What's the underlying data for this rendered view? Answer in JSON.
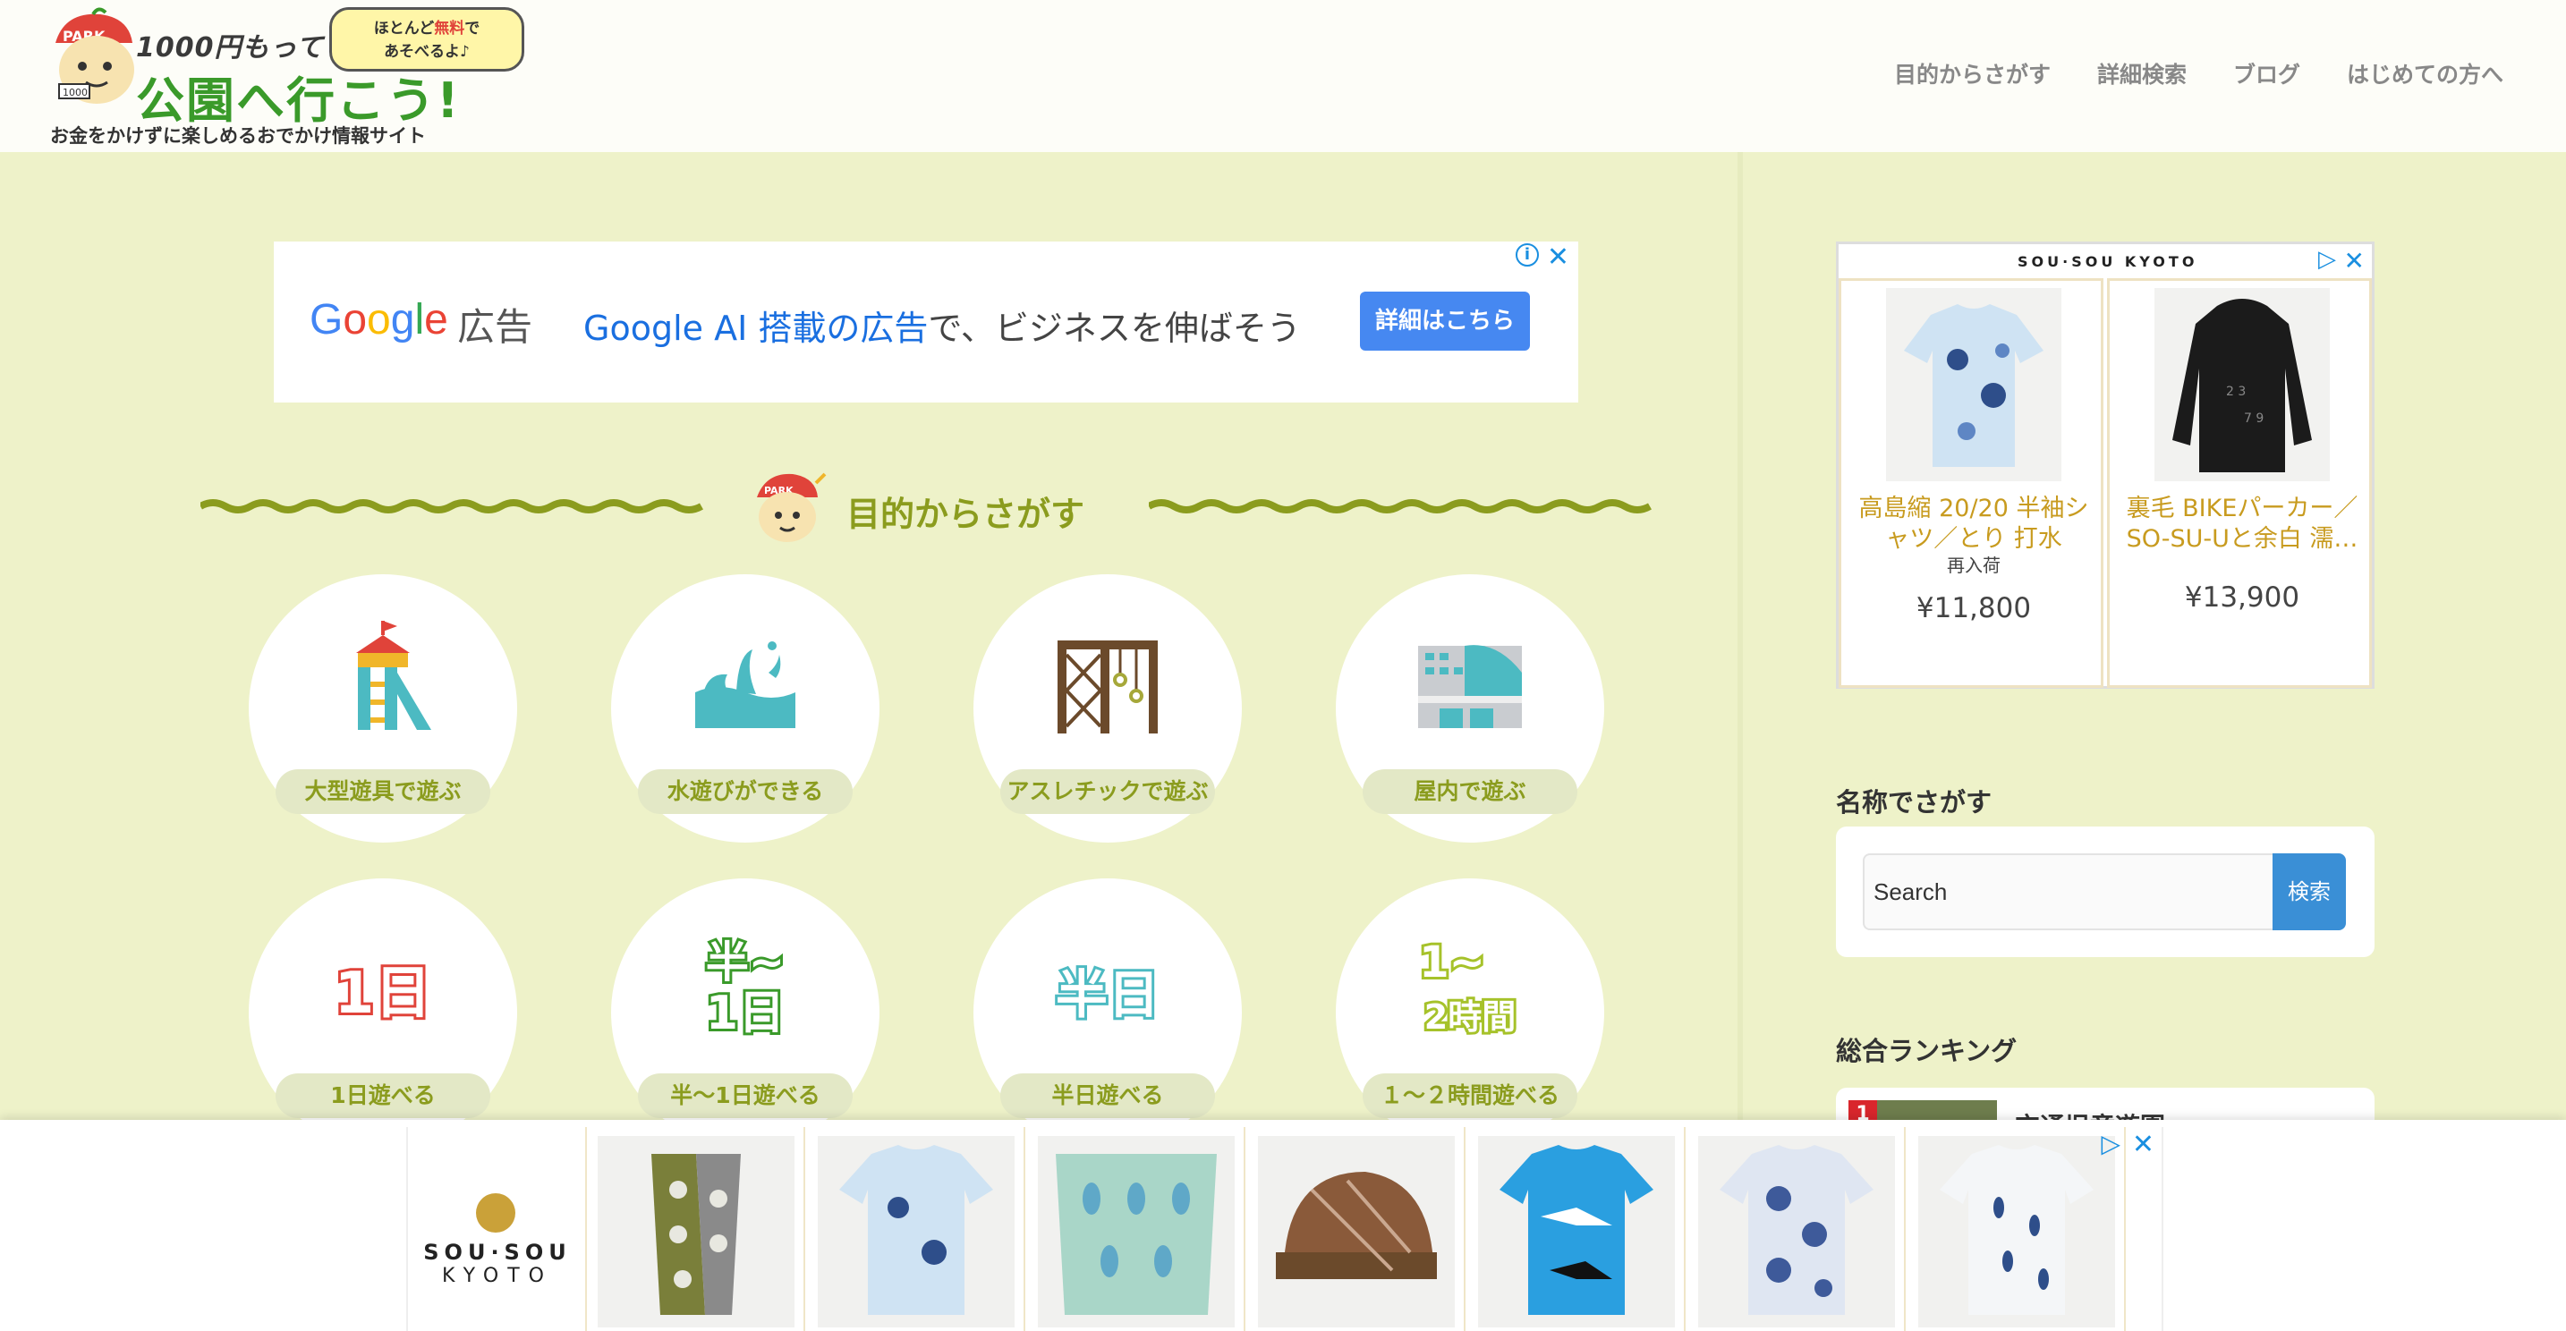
{
  "header": {
    "logo_title": "1000円もって",
    "logo_title2": "公園へ行こう!",
    "logo_bubble_line1": "ほとんど",
    "logo_bubble_red": "無料",
    "logo_bubble_line1b": "で",
    "logo_bubble_line2": "あそべるよ♪",
    "tagline": "お金をかけずに楽しめるおでかけ情報サイト",
    "nav": [
      "目的からさがす",
      "詳細検索",
      "ブログ",
      "はじめての方へ"
    ]
  },
  "top_ad": {
    "google": "Google",
    "label": "広告",
    "headline_blue": "Google AI 搭載の広告",
    "headline_rest": "で、ビジネスを伸ばそう",
    "cta": "詳細はこちら"
  },
  "section": {
    "title": "目的からさがす"
  },
  "tiles": [
    {
      "label": "大型遊具で遊ぶ",
      "icon": "playground-icon"
    },
    {
      "label": "水遊びができる",
      "icon": "water-splash-icon"
    },
    {
      "label": "アスレチックで遊ぶ",
      "icon": "athletic-frame-icon"
    },
    {
      "label": "屋内で遊ぶ",
      "icon": "indoor-building-icon"
    },
    {
      "label": "1日遊べる",
      "icon": "one-day-icon",
      "glyph": "1日"
    },
    {
      "label": "半～1日遊べる",
      "icon": "half-to-one-day-icon",
      "glyph1": "半~",
      "glyph2": "1日"
    },
    {
      "label": "半日遊べる",
      "icon": "half-day-icon",
      "glyph": "半日"
    },
    {
      "label": "１～２時間遊べる",
      "icon": "one-two-hours-icon",
      "glyph1": "1~",
      "glyph2": "2時間"
    }
  ],
  "side_ad": {
    "brand": "SOU·SOU KYOTO",
    "products": [
      {
        "name": "高島縮 20/20 半袖シャツ／とり 打水",
        "sub": "再入荷",
        "price": "¥11,800"
      },
      {
        "name": "裏毛 BIKEパーカー／SO-SU-Uと余白 濡…",
        "sub": "",
        "price": "¥13,900"
      }
    ]
  },
  "search": {
    "title": "名称でさがす",
    "placeholder": "Search",
    "button": "検索"
  },
  "ranking": {
    "title": "総合ランキング",
    "first_rank": "1",
    "first_name": "交通児童遊園"
  },
  "bottom_ad": {
    "brand_line1": "SOU·SOU",
    "brand_line2": "KYOTO",
    "product_count": 7
  },
  "colors": {
    "page_bg": "#eef2c9",
    "accent_olive": "#8b9c1e",
    "price_gold": "#c89b1f",
    "search_button": "#3a8fd6"
  }
}
